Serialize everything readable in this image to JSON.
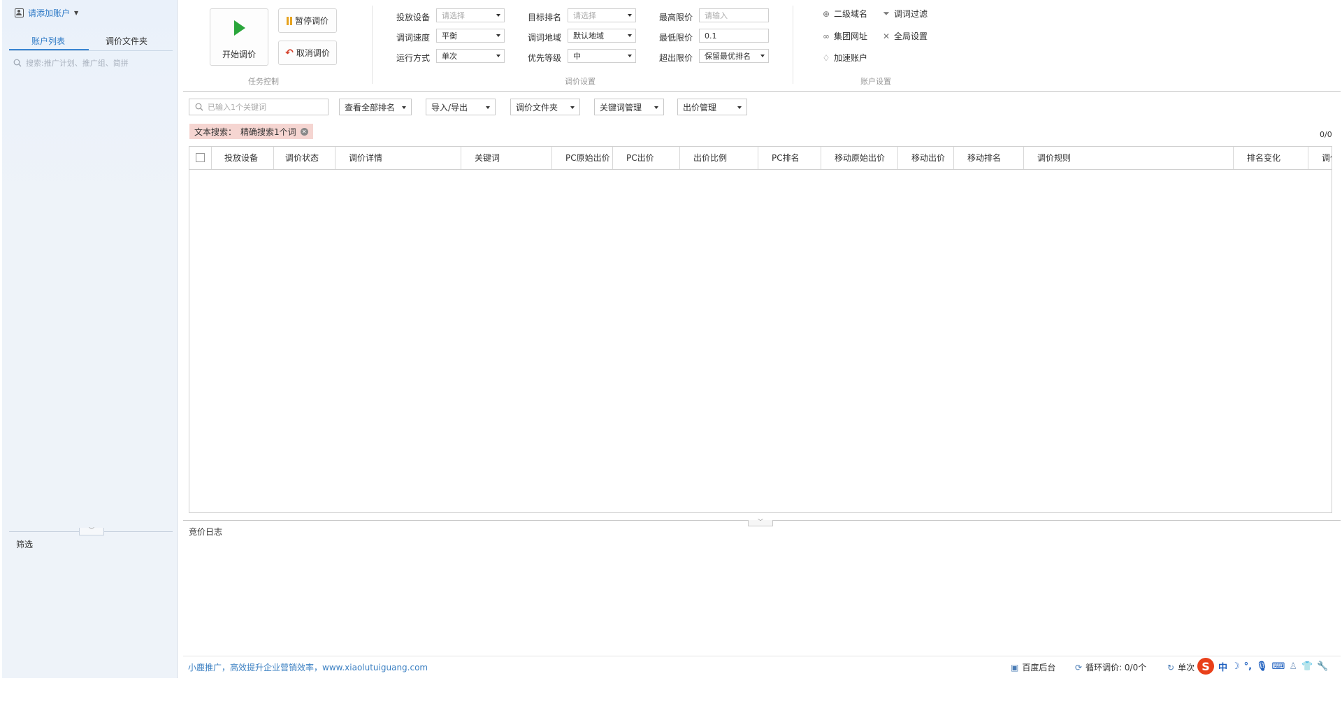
{
  "sidebar": {
    "account_label": "请添加账户",
    "tabs": [
      {
        "label": "账户列表",
        "active": true
      },
      {
        "label": "调价文件夹",
        "active": false
      }
    ],
    "search_placeholder": "搜索:推广计划、推广组、简拼",
    "filter_label": "筛选"
  },
  "ribbon": {
    "task_control": {
      "title": "任务控制",
      "start_label": "开始调价",
      "pause_label": "暂停调价",
      "cancel_label": "取消调价"
    },
    "bid_settings": {
      "title": "调价设置",
      "device_label": "投放设备",
      "device_value": "请选择",
      "speed_label": "调词速度",
      "speed_value": "平衡",
      "run_mode_label": "运行方式",
      "run_mode_value": "单次",
      "target_rank_label": "目标排名",
      "target_rank_value": "请选择",
      "region_label": "调词地域",
      "region_value": "默认地域",
      "priority_label": "优先等级",
      "priority_value": "中",
      "max_price_label": "最高限价",
      "max_price_placeholder": "请输入",
      "min_price_label": "最低限价",
      "min_price_value": "0.1",
      "exceed_label": "超出限价",
      "exceed_value": "保留最优排名"
    },
    "account_settings": {
      "title": "账户设置",
      "subdomain": "二级域名",
      "word_filter": "调词过滤",
      "group_url": "集团网址",
      "global_settings": "全局设置",
      "speed_account": "加速账户"
    }
  },
  "toolbar": {
    "search_placeholder": "已输入1个关键词",
    "view_all_rank": "查看全部排名",
    "import_export": "导入/导出",
    "bid_folder": "调价文件夹",
    "keyword_manage": "关键词管理",
    "bid_manage": "出价管理"
  },
  "filter_tag": {
    "prefix": "文本搜索：",
    "value": "精确搜索1个词"
  },
  "count": "0/0",
  "table": {
    "columns": [
      "投放设备",
      "调价状态",
      "调价详情",
      "关键词",
      "PC原始出价",
      "PC出价",
      "出价比例",
      "PC排名",
      "移动原始出价",
      "移动出价",
      "移动排名",
      "调价规则",
      "排名变化",
      "调价"
    ],
    "rows": []
  },
  "log": {
    "title": "竞价日志"
  },
  "status_bar": {
    "slogan": "小鹿推广，高效提升企业营销效率，www.xiaolutuiguang.com",
    "baidu_backend": "百度后台",
    "loop_bid": "循环调价: 0/0个",
    "single": "单次"
  },
  "ime": {
    "logo": "S",
    "mode": "中"
  }
}
